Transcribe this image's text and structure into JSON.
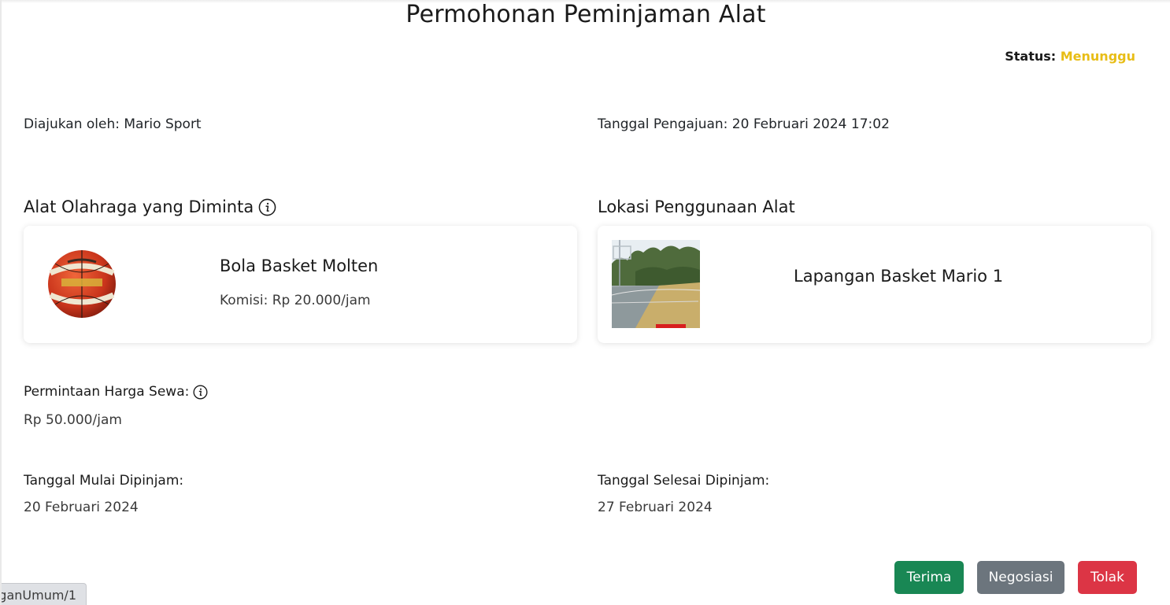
{
  "header": {
    "title": "Permohonan Peminjaman Alat",
    "status_label": "Status:",
    "status_value": "Menunggu"
  },
  "meta": {
    "submitted_by": "Diajukan oleh: Mario Sport",
    "submission_date": "Tanggal Pengajuan: 20 Februari 2024 17:02"
  },
  "tool_section": {
    "title": "Alat Olahraga yang Diminta",
    "name": "Bola Basket Molten",
    "commission": "Komisi: Rp 20.000/jam"
  },
  "location_section": {
    "title": "Lokasi Penggunaan Alat",
    "name": "Lapangan Basket Mario 1"
  },
  "price": {
    "label": "Permintaan Harga Sewa:",
    "value": "Rp 50.000/jam"
  },
  "dates": {
    "start_label": "Tanggal Mulai Dipinjam:",
    "start_value": "20 Februari 2024",
    "end_label": "Tanggal Selesai Dipinjam:",
    "end_value": "27 Februari 2024"
  },
  "actions": {
    "accept_label": "Terima",
    "negotiate_label": "Negosiasi",
    "reject_label": "Tolak"
  },
  "url_hint": "...ganUmum/1",
  "colors": {
    "status": "#e8bd16",
    "accept": "#198754",
    "negotiate": "#6c757d",
    "reject": "#dc3545"
  },
  "icons": {
    "info": "info-circle-icon"
  }
}
